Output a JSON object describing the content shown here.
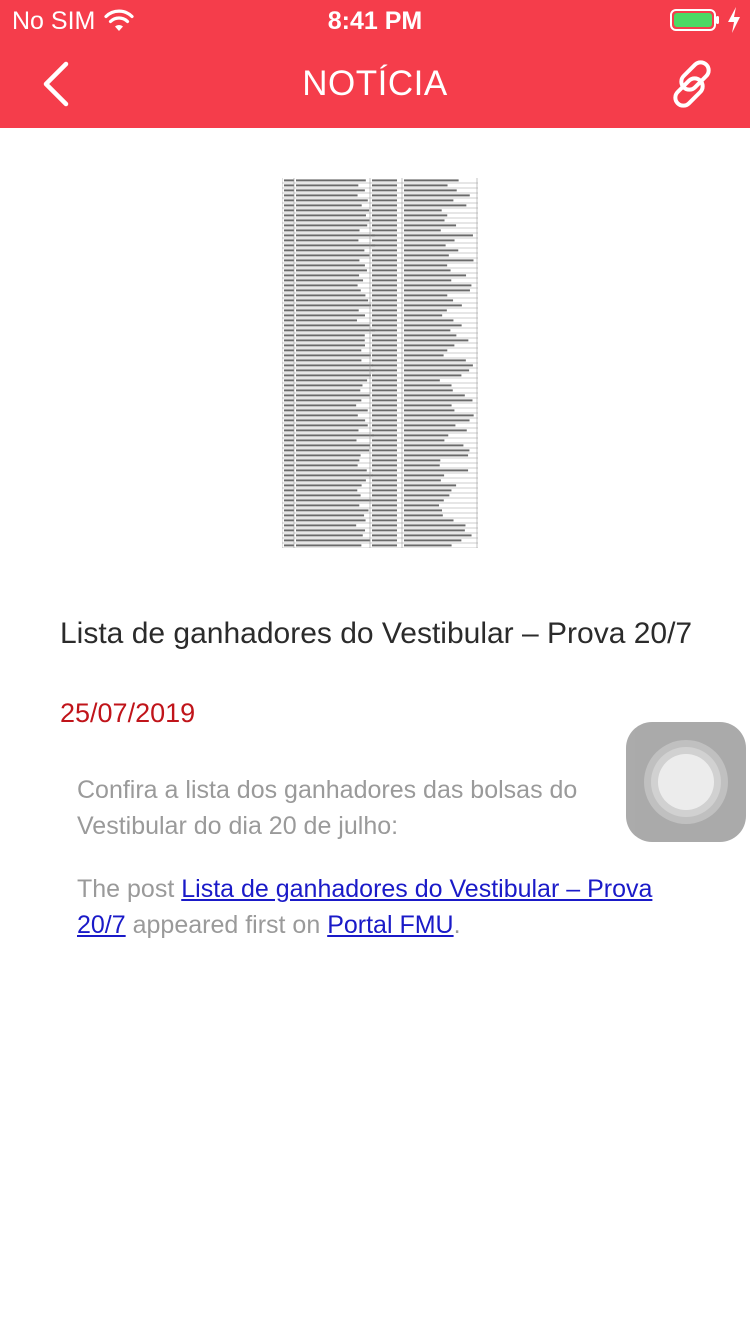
{
  "status_bar": {
    "carrier": "No SIM",
    "time": "8:41 PM",
    "wifi_icon": "wifi-icon",
    "battery_icon": "battery-icon",
    "charging_icon": "bolt-icon"
  },
  "nav": {
    "title": "NOTÍCIA",
    "back_icon": "chevron-left-icon",
    "link_icon": "link-icon"
  },
  "article": {
    "image_icon": "document-thumbnail",
    "title": "Lista de ganhadores do Vestibular – Prova 20/7",
    "date": "25/07/2019",
    "intro": "Confira a lista dos ganhadores das bolsas do Vestibular do dia 20 de julho:",
    "footer": {
      "prefix": "The post ",
      "post_link": "Lista de ganhadores do Vestibular – Prova 20/7",
      "middle": " appeared first on ",
      "site_link": "Portal FMU",
      "suffix": "."
    }
  },
  "colors": {
    "header": "#f53d4b",
    "date": "#c0141a",
    "link": "#1a1ac8",
    "body_text": "#9a9a9a"
  }
}
